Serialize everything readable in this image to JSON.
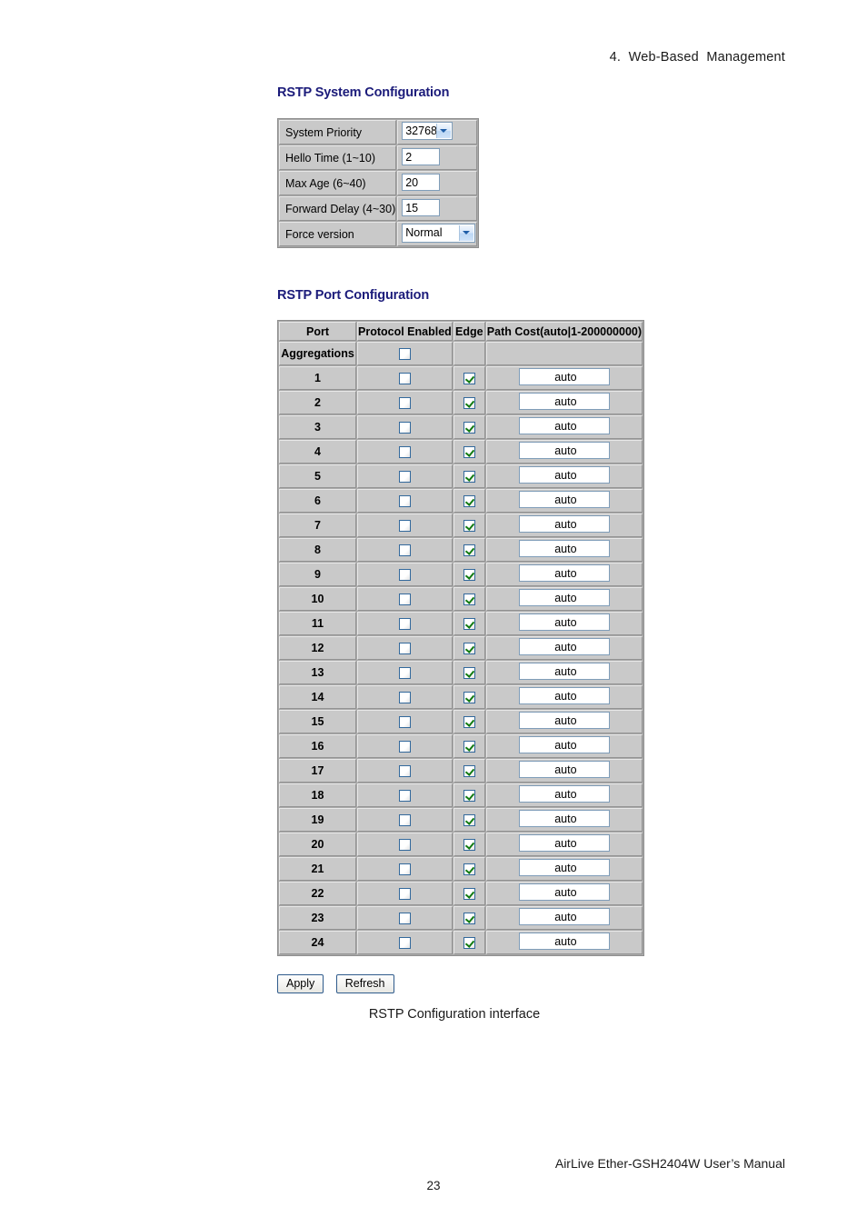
{
  "page": {
    "header": "4.  Web-Based  Management",
    "footer_manual": "AirLive Ether-GSH2404W User’s Manual",
    "page_number": "23",
    "figure_caption": "RSTP Configuration interface",
    "heading_color": "#1b1b7a"
  },
  "system_config": {
    "heading": "RSTP System Configuration",
    "rows": [
      {
        "label": "System Priority",
        "control": "select",
        "value": "32768"
      },
      {
        "label": "Hello Time (1~10)",
        "control": "text",
        "value": "2"
      },
      {
        "label": "Max Age (6~40)",
        "control": "text",
        "value": "20"
      },
      {
        "label": "Forward Delay (4~30)",
        "control": "text",
        "value": "15"
      },
      {
        "label": "Force version",
        "control": "select",
        "value": "Normal"
      }
    ]
  },
  "port_config": {
    "heading": "RSTP Port Configuration",
    "columns": [
      "Port",
      "Protocol Enabled",
      "Edge",
      "Path Cost(auto|1-200000000)"
    ],
    "rows": [
      {
        "port": "Aggregations",
        "protocol_enabled": false,
        "edge": null,
        "path_cost": null
      },
      {
        "port": "1",
        "protocol_enabled": false,
        "edge": true,
        "path_cost": "auto"
      },
      {
        "port": "2",
        "protocol_enabled": false,
        "edge": true,
        "path_cost": "auto"
      },
      {
        "port": "3",
        "protocol_enabled": false,
        "edge": true,
        "path_cost": "auto"
      },
      {
        "port": "4",
        "protocol_enabled": false,
        "edge": true,
        "path_cost": "auto"
      },
      {
        "port": "5",
        "protocol_enabled": false,
        "edge": true,
        "path_cost": "auto"
      },
      {
        "port": "6",
        "protocol_enabled": false,
        "edge": true,
        "path_cost": "auto"
      },
      {
        "port": "7",
        "protocol_enabled": false,
        "edge": true,
        "path_cost": "auto"
      },
      {
        "port": "8",
        "protocol_enabled": false,
        "edge": true,
        "path_cost": "auto"
      },
      {
        "port": "9",
        "protocol_enabled": false,
        "edge": true,
        "path_cost": "auto"
      },
      {
        "port": "10",
        "protocol_enabled": false,
        "edge": true,
        "path_cost": "auto"
      },
      {
        "port": "11",
        "protocol_enabled": false,
        "edge": true,
        "path_cost": "auto"
      },
      {
        "port": "12",
        "protocol_enabled": false,
        "edge": true,
        "path_cost": "auto"
      },
      {
        "port": "13",
        "protocol_enabled": false,
        "edge": true,
        "path_cost": "auto"
      },
      {
        "port": "14",
        "protocol_enabled": false,
        "edge": true,
        "path_cost": "auto"
      },
      {
        "port": "15",
        "protocol_enabled": false,
        "edge": true,
        "path_cost": "auto"
      },
      {
        "port": "16",
        "protocol_enabled": false,
        "edge": true,
        "path_cost": "auto"
      },
      {
        "port": "17",
        "protocol_enabled": false,
        "edge": true,
        "path_cost": "auto"
      },
      {
        "port": "18",
        "protocol_enabled": false,
        "edge": true,
        "path_cost": "auto"
      },
      {
        "port": "19",
        "protocol_enabled": false,
        "edge": true,
        "path_cost": "auto"
      },
      {
        "port": "20",
        "protocol_enabled": false,
        "edge": true,
        "path_cost": "auto"
      },
      {
        "port": "21",
        "protocol_enabled": false,
        "edge": true,
        "path_cost": "auto"
      },
      {
        "port": "22",
        "protocol_enabled": false,
        "edge": true,
        "path_cost": "auto"
      },
      {
        "port": "23",
        "protocol_enabled": false,
        "edge": true,
        "path_cost": "auto"
      },
      {
        "port": "24",
        "protocol_enabled": false,
        "edge": true,
        "path_cost": "auto"
      }
    ]
  },
  "buttons": {
    "apply": "Apply",
    "refresh": "Refresh"
  }
}
